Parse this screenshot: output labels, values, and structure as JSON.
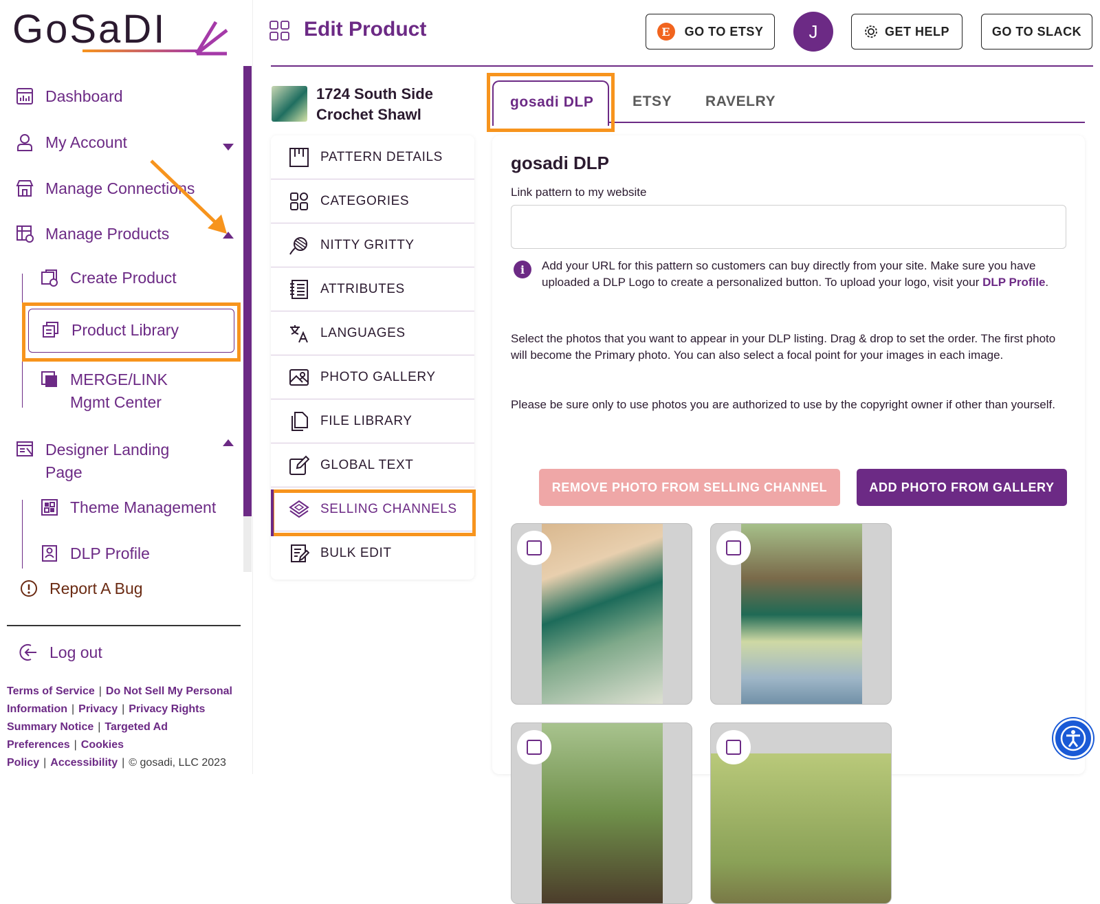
{
  "brand": {
    "logo_text": "GoSadi",
    "accent": "#6c2a85",
    "highlight": "#f7941d"
  },
  "sidebar": {
    "items": [
      {
        "label": "Dashboard",
        "icon": "dashboard-icon"
      },
      {
        "label": "My Account",
        "icon": "user-icon"
      },
      {
        "label": "Manage Connections",
        "icon": "store-icon"
      },
      {
        "label": "Manage Products",
        "icon": "products-icon"
      },
      {
        "label": "Create Product",
        "icon": "create-product-icon"
      },
      {
        "label": "Product Library",
        "icon": "library-icon"
      },
      {
        "label": "MERGE/LINK",
        "label2": "Mgmt Center",
        "icon": "merge-icon"
      },
      {
        "label": "Designer Landing",
        "label2": "Page",
        "icon": "landing-page-icon"
      },
      {
        "label": "Theme Management",
        "icon": "theme-icon"
      },
      {
        "label": "DLP Profile",
        "icon": "profile-icon"
      },
      {
        "label": "Report A Bug",
        "icon": "alert-icon"
      },
      {
        "label": "Log out",
        "icon": "logout-icon"
      }
    ],
    "footer": {
      "links": [
        "Terms of Service",
        "Do Not Sell My Personal Information",
        "Privacy",
        "Privacy Rights Summary Notice",
        "Targeted Ad Preferences",
        "Cookies Policy",
        "Accessibility"
      ],
      "copyright": "© gosadi, LLC 2023"
    }
  },
  "header": {
    "title": "Edit Product",
    "etsy_button": "GO TO ETSY",
    "etsy_letter": "E",
    "avatar_letter": "J",
    "help_button": "GET HELP",
    "slack_button": "GO TO SLACK"
  },
  "product": {
    "name_line1": "1724 South Side",
    "name_line2": "Crochet Shawl"
  },
  "menu": [
    {
      "label": "PATTERN DETAILS",
      "icon": "pattern-icon"
    },
    {
      "label": "CATEGORIES",
      "icon": "categories-icon"
    },
    {
      "label": "NITTY GRITTY",
      "icon": "yarn-icon"
    },
    {
      "label": "ATTRIBUTES",
      "icon": "attributes-icon"
    },
    {
      "label": "LANGUAGES",
      "icon": "translate-icon"
    },
    {
      "label": "PHOTO GALLERY",
      "icon": "image-icon"
    },
    {
      "label": "FILE LIBRARY",
      "icon": "file-icon"
    },
    {
      "label": "GLOBAL TEXT",
      "icon": "edit-icon"
    },
    {
      "label": "SELLING CHANNELS",
      "icon": "layers-icon"
    },
    {
      "label": "BULK EDIT",
      "icon": "bulk-edit-icon"
    }
  ],
  "tabs": [
    "gosadi DLP",
    "ETSY",
    "RAVELRY"
  ],
  "panel": {
    "heading": "gosadi DLP",
    "link_label": "Link pattern to my website",
    "link_value": "",
    "info_text": "Add your URL for this pattern so customers can buy directly from your site. Make sure you have uploaded a DLP Logo to create a personalized button. To upload your logo, visit your ",
    "info_link": "DLP Profile",
    "info_end": ".",
    "para1": "Select the photos that you want to appear in your DLP listing. Drag & drop to set the order. The first photo will become the Primary photo. You can also select a focal point for your images in each image.",
    "para2": "Please be sure only to use photos you are authorized to use by the copyright owner if other than yourself.",
    "remove_button": "REMOVE PHOTO FROM SELLING CHANNEL",
    "add_button": "ADD PHOTO FROM GALLERY"
  }
}
